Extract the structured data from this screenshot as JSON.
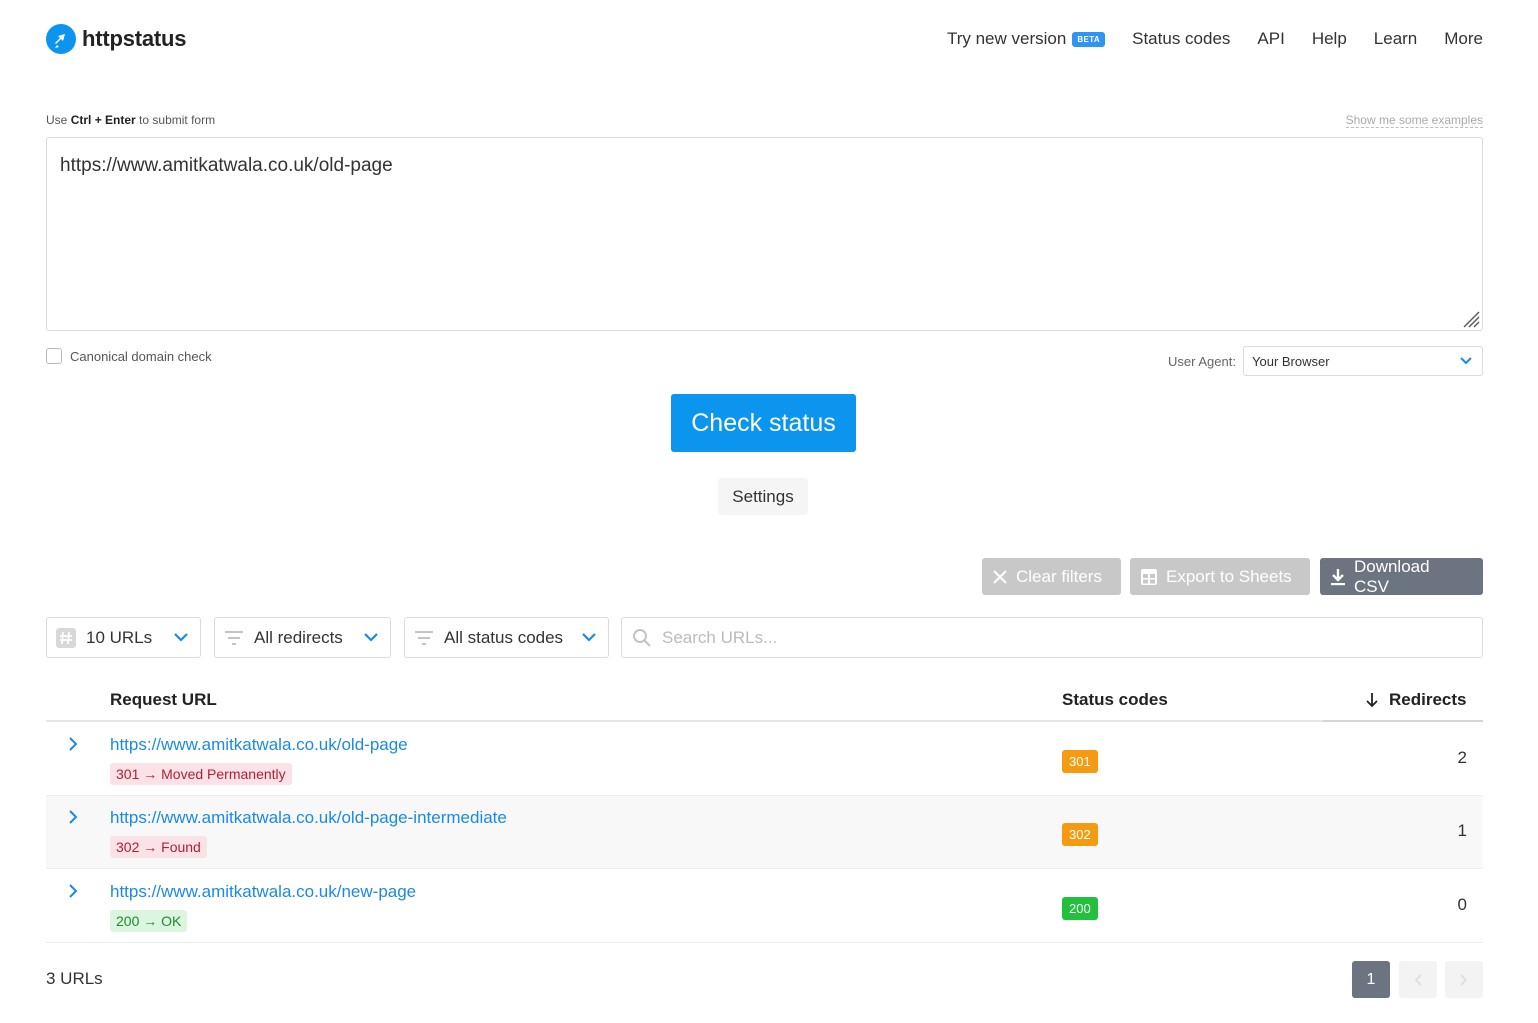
{
  "brand": {
    "name": "httpstatus",
    "color": "#0c95ef"
  },
  "nav": {
    "try_new": "Try new version",
    "beta": "BETA",
    "status_codes": "Status codes",
    "api": "API",
    "help": "Help",
    "learn": "Learn",
    "more": "More"
  },
  "form": {
    "hint_prefix": "Use",
    "hint_keys": "Ctrl + Enter",
    "hint_suffix": "to submit form",
    "examples_link": "Show me some examples",
    "urls_value": "https://www.amitkatwala.co.uk/old-page",
    "canonical_label": "Canonical domain check",
    "canonical_checked": false,
    "user_agent_label": "User Agent:",
    "user_agent_value": "Your Browser",
    "submit_label": "Check status",
    "settings_label": "Settings"
  },
  "actions": {
    "clear_filters": "Clear filters",
    "export_sheets": "Export to Sheets",
    "download_csv": "Download CSV"
  },
  "filters": {
    "urls": "10 URLs",
    "redirects": "All redirects",
    "status_codes": "All status codes",
    "search_placeholder": "Search URLs..."
  },
  "table": {
    "columns": {
      "url": "Request URL",
      "status": "Status codes",
      "redirects": "Redirects"
    },
    "rows": [
      {
        "url": "https://www.amitkatwala.co.uk/old-page",
        "code": "301",
        "arrow": "→",
        "message": "Moved Permanently",
        "badge": "301",
        "redirects": "2",
        "badge_color": "#f49b12"
      },
      {
        "url": "https://www.amitkatwala.co.uk/old-page-intermediate",
        "code": "302",
        "arrow": "→",
        "message": "Found",
        "badge": "302",
        "redirects": "1",
        "badge_color": "#f49b12"
      },
      {
        "url": "https://www.amitkatwala.co.uk/new-page",
        "code": "200",
        "arrow": "→",
        "message": "OK",
        "badge": "200",
        "redirects": "0",
        "badge_color": "#22c03c"
      }
    ]
  },
  "footer": {
    "count": "3 URLs",
    "current_page": "1"
  }
}
